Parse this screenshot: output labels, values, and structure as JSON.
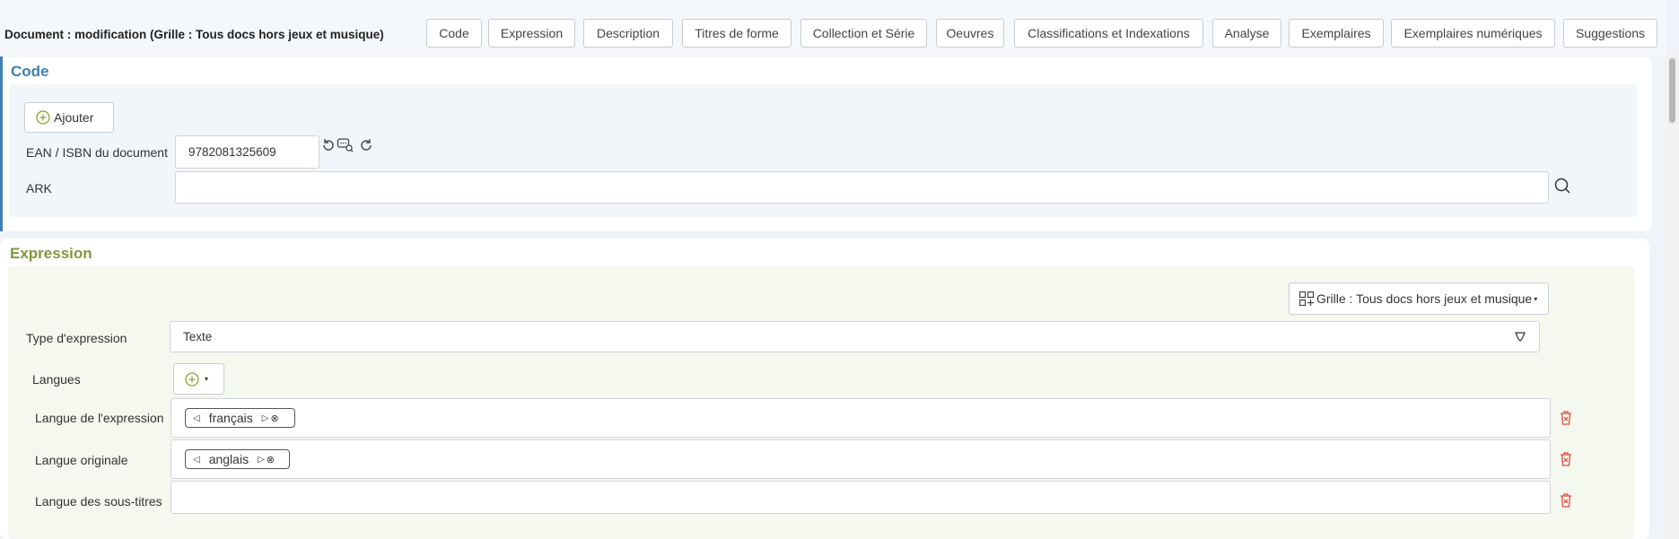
{
  "header": {
    "title": "Document : modification (Grille : Tous docs hors jeux et musique)",
    "tabs": [
      {
        "label": "Code"
      },
      {
        "label": "Expression"
      },
      {
        "label": "Description"
      },
      {
        "label": "Titres de forme"
      },
      {
        "label": "Collection et Série"
      },
      {
        "label": "Oeuvres"
      },
      {
        "label": "Classifications et Indexations"
      },
      {
        "label": "Analyse"
      },
      {
        "label": "Exemplaires"
      },
      {
        "label": "Exemplaires numériques"
      },
      {
        "label": "Suggestions"
      }
    ]
  },
  "code": {
    "title": "Code",
    "add_label": "Ajouter",
    "ean_label": "EAN / ISBN du document",
    "ean_value": "9782081325609",
    "ark_label": "ARK",
    "ark_value": ""
  },
  "expression": {
    "title": "Expression",
    "grid_button": "Grille : Tous docs hors jeux et musique",
    "type_label": "Type d'expression",
    "type_value": "Texte",
    "langues_label": "Langues",
    "lang_expr_label": "Langue de l'expression",
    "lang_expr_value": "français",
    "lang_orig_label": "Langue originale",
    "lang_orig_value": "anglais",
    "lang_sub_label": "Langue des sous-titres",
    "lang_sub_value": ""
  },
  "colors": {
    "code_title": "#3f7fb5",
    "expression_title": "#7d9a3a",
    "code_bg": "#f1f6fa",
    "expression_bg": "#f5f8ef",
    "delete_red": "#e04a3c",
    "add_green": "#8aa22e"
  }
}
